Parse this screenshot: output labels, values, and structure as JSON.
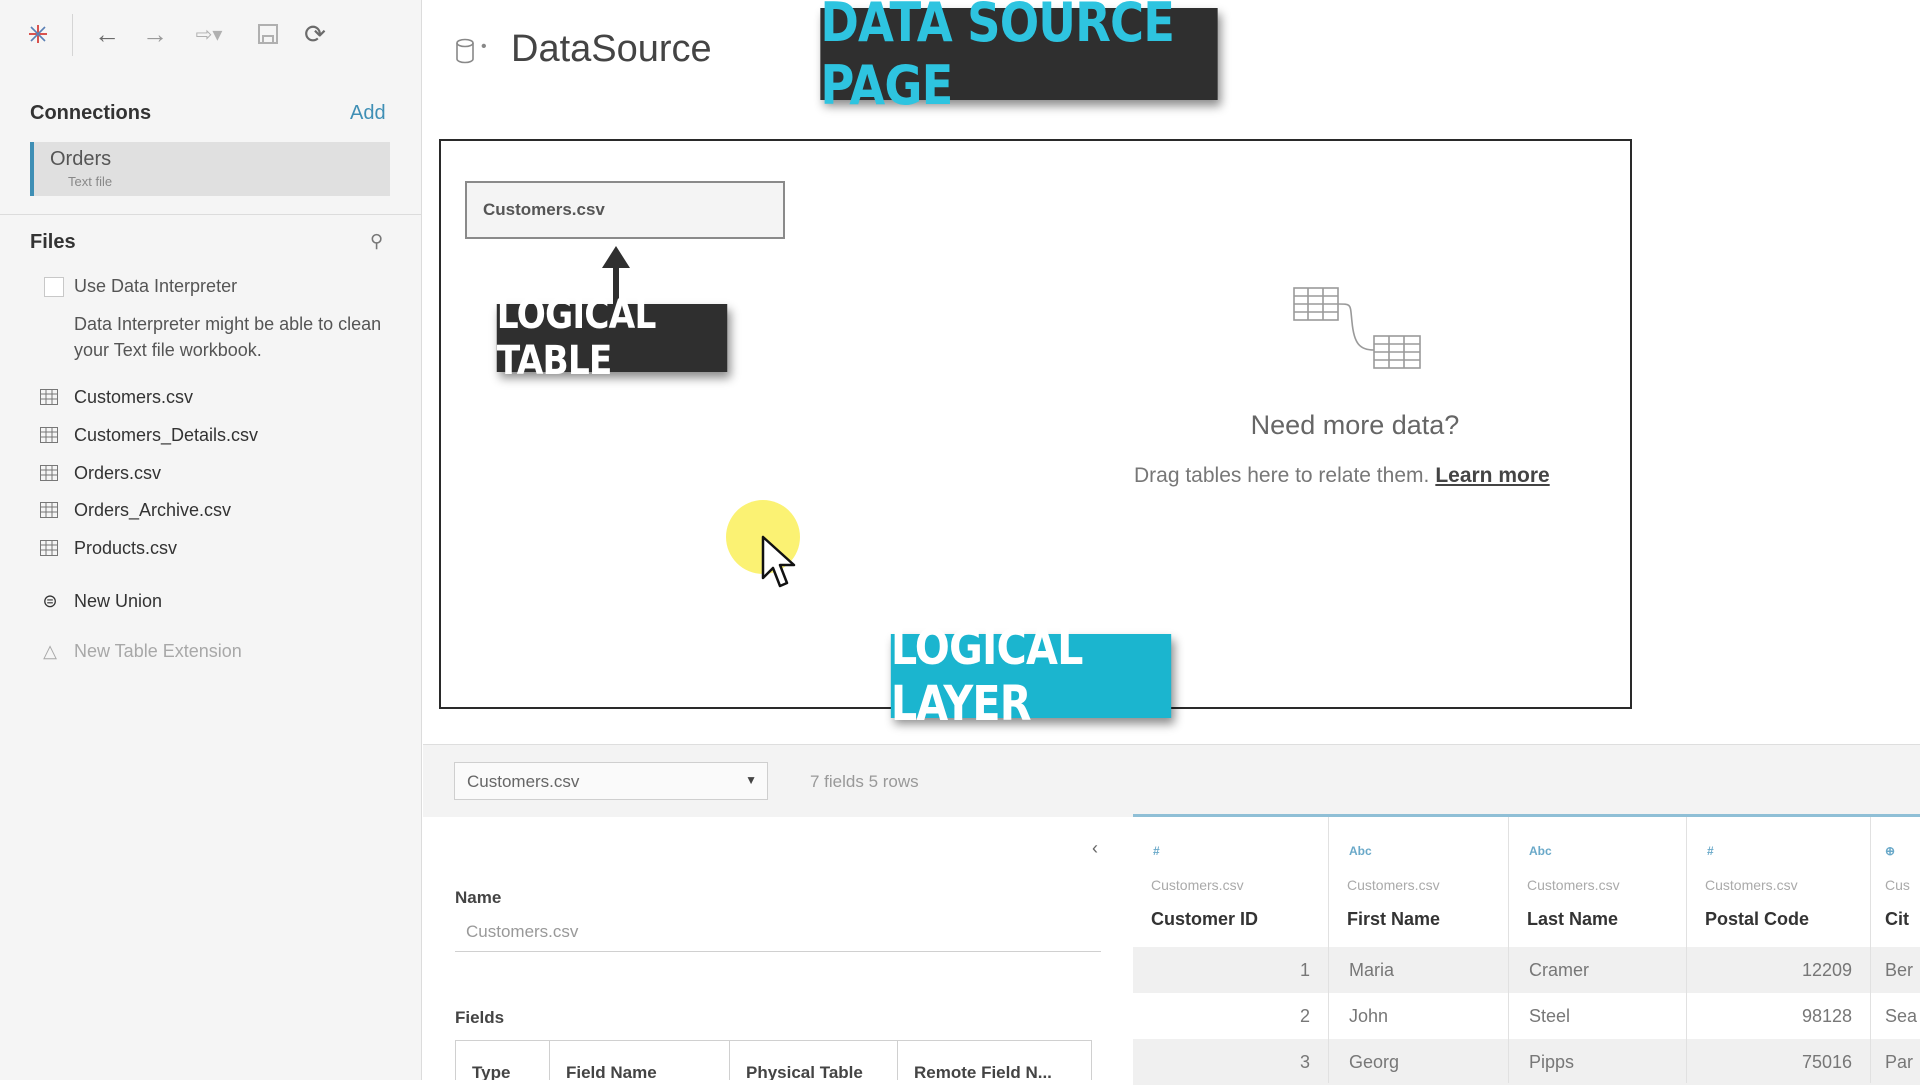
{
  "sidebar": {
    "connections_title": "Connections",
    "add_label": "Add",
    "connection": {
      "name": "Orders",
      "type": "Text file"
    },
    "files_title": "Files",
    "use_interpreter_label": "Use Data Interpreter",
    "interpreter_desc": "Data Interpreter might be able to clean your Text file workbook.",
    "files": [
      "Customers.csv",
      "Customers_Details.csv",
      "Orders.csv",
      "Orders_Archive.csv",
      "Products.csv"
    ],
    "new_union": "New Union",
    "new_table_extension": "New Table Extension"
  },
  "header": {
    "title": "DataSource"
  },
  "overlays": {
    "page_label": "DATA SOURCE PAGE",
    "table_label": "LOGICAL TABLE",
    "layer_label": "LOGICAL LAYER"
  },
  "canvas": {
    "table_name": "Customers.csv",
    "need_more": "Need more data?",
    "drag_text": "Drag tables here to relate them.",
    "learn_more": "Learn more"
  },
  "bottom": {
    "selected_table": "Customers.csv",
    "rows_info": "7 fields 5 rows"
  },
  "meta": {
    "name_label": "Name",
    "name_value": "Customers.csv",
    "fields_label": "Fields",
    "fields_headers": [
      "Type",
      "Field Name",
      "Physical Table",
      "Remote Field N..."
    ]
  },
  "grid": {
    "columns": [
      {
        "type": "#",
        "source": "Customers.csv",
        "name": "Customer ID"
      },
      {
        "type": "Abc",
        "source": "Customers.csv",
        "name": "First Name"
      },
      {
        "type": "Abc",
        "source": "Customers.csv",
        "name": "Last Name"
      },
      {
        "type": "#",
        "source": "Customers.csv",
        "name": "Postal Code"
      },
      {
        "type": "⊕",
        "source": "Cus",
        "name": "Cit"
      }
    ],
    "rows": [
      [
        "1",
        "Maria",
        "Cramer",
        "12209",
        "Ber"
      ],
      [
        "2",
        "John",
        "Steel",
        "98128",
        "Sea"
      ],
      [
        "3",
        "Georg",
        "Pipps",
        "75016",
        "Par"
      ]
    ]
  },
  "colors": {
    "accent": "#3f8fb5",
    "overlay_cyan": "#1bb5cf",
    "overlay_dark": "#2f2f2f"
  }
}
